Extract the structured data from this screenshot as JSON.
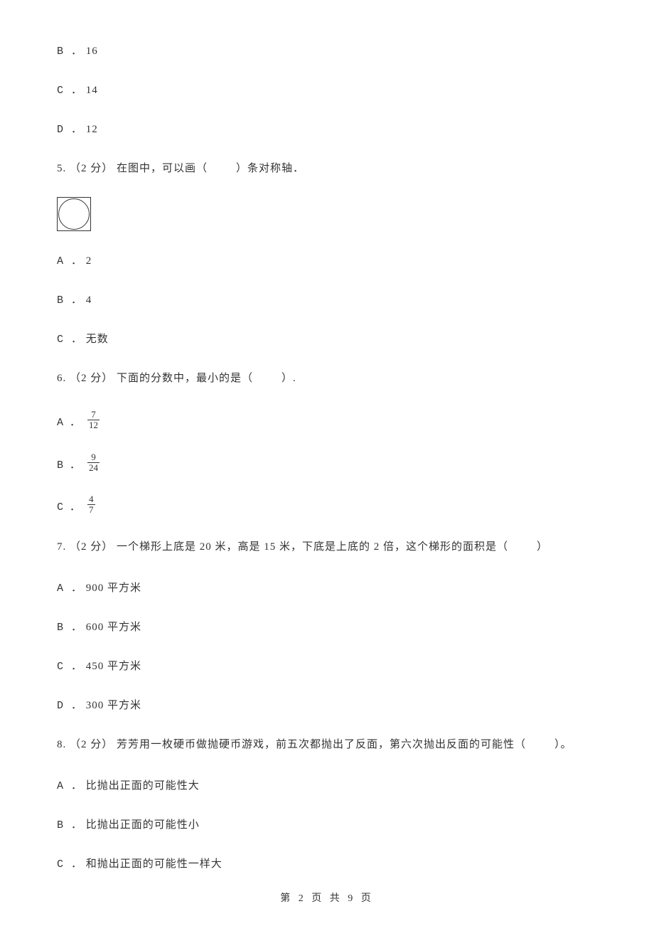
{
  "q4_continued": {
    "options": [
      {
        "label": "B ．",
        "text": "16"
      },
      {
        "label": "C ．",
        "text": "14"
      },
      {
        "label": "D ．",
        "text": "12"
      }
    ]
  },
  "q5": {
    "number": "5.",
    "points": "（2 分）",
    "text_before": " 在图中，可以画（",
    "text_after": "）条对称轴．",
    "options": [
      {
        "label": "A ．",
        "text": "2"
      },
      {
        "label": "B ．",
        "text": "4"
      },
      {
        "label": "C ．",
        "text": "无数"
      }
    ]
  },
  "q6": {
    "number": "6.",
    "points": "（2 分）",
    "text_before": " 下面的分数中，最小的是（",
    "text_after": "）.",
    "options": [
      {
        "label": "A ．",
        "num": "7",
        "den": "12"
      },
      {
        "label": "B ．",
        "num": "9",
        "den": "24"
      },
      {
        "label": "C ．",
        "num": "4",
        "den": "7"
      }
    ]
  },
  "q7": {
    "number": "7.",
    "points": "（2 分）",
    "text_before": " 一个梯形上底是 20 米，高是 15 米，下底是上底的 2 倍，这个梯形的面积是（",
    "text_after": "）",
    "options": [
      {
        "label": "A ．",
        "text": "900 平方米"
      },
      {
        "label": "B ．",
        "text": "600 平方米"
      },
      {
        "label": "C ．",
        "text": "450 平方米"
      },
      {
        "label": "D ．",
        "text": "300 平方米"
      }
    ]
  },
  "q8": {
    "number": "8.",
    "points": "（2 分）",
    "text_before": " 芳芳用一枚硬币做抛硬币游戏，前五次都抛出了反面，第六次抛出反面的可能性（",
    "text_after": "）。",
    "options": [
      {
        "label": "A ．",
        "text": "比抛出正面的可能性大"
      },
      {
        "label": "B ．",
        "text": "比抛出正面的可能性小"
      },
      {
        "label": "C ．",
        "text": "和抛出正面的可能性一样大"
      }
    ]
  },
  "footer": "第 2 页 共 9 页"
}
